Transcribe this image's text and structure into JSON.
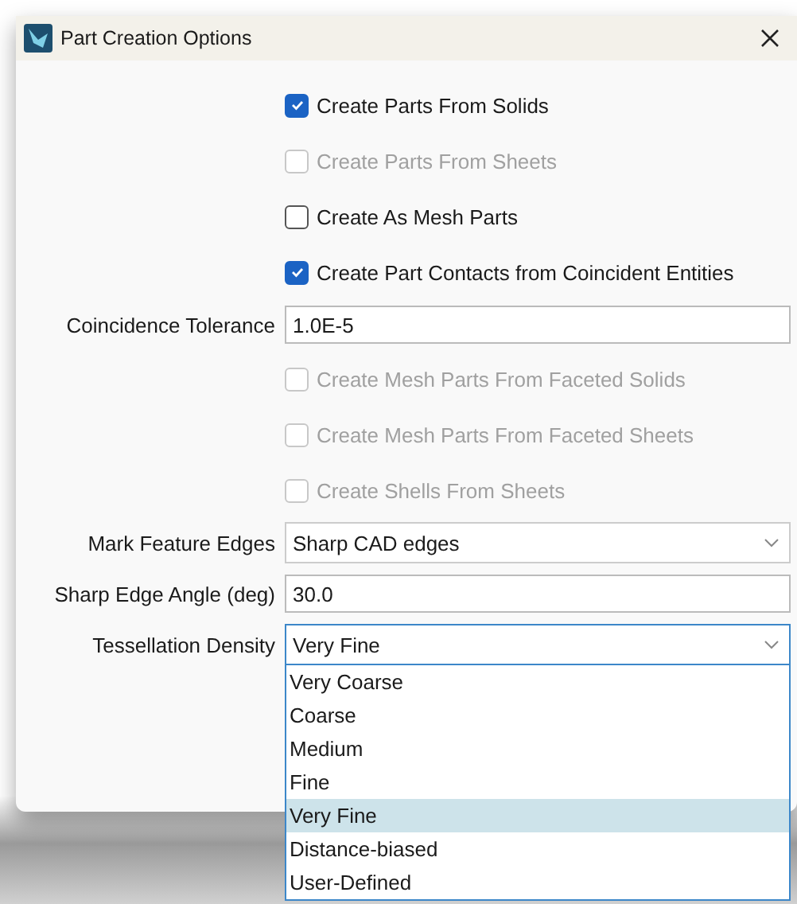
{
  "window": {
    "title": "Part Creation Options"
  },
  "rows": [
    {
      "kind": "checkbox",
      "label": "Create Parts From Solids",
      "checked": true,
      "disabled": false
    },
    {
      "kind": "checkbox",
      "label": "Create Parts From Sheets",
      "checked": false,
      "disabled": true
    },
    {
      "kind": "checkbox",
      "label": "Create As Mesh Parts",
      "checked": false,
      "disabled": false
    },
    {
      "kind": "checkbox",
      "label": "Create Part Contacts from Coincident Entities",
      "checked": true,
      "disabled": false
    },
    {
      "kind": "text",
      "label": "Coincidence Tolerance",
      "value": "1.0E-5"
    },
    {
      "kind": "checkbox",
      "label": "Create Mesh Parts From Faceted Solids",
      "checked": false,
      "disabled": true
    },
    {
      "kind": "checkbox",
      "label": "Create Mesh Parts From Faceted Sheets",
      "checked": false,
      "disabled": true
    },
    {
      "kind": "checkbox",
      "label": "Create Shells From Sheets",
      "checked": false,
      "disabled": true
    },
    {
      "kind": "combo",
      "label": "Mark Feature Edges",
      "value": "Sharp CAD edges",
      "expanded": false
    },
    {
      "kind": "text",
      "label": "Sharp Edge Angle (deg)",
      "value": "30.0"
    },
    {
      "kind": "combo",
      "label": "Tessellation Density",
      "value": "Very Fine",
      "expanded": true,
      "options": [
        {
          "label": "Very Coarse",
          "selected": false
        },
        {
          "label": "Coarse",
          "selected": false
        },
        {
          "label": "Medium",
          "selected": false
        },
        {
          "label": "Fine",
          "selected": false
        },
        {
          "label": "Very Fine",
          "selected": true
        },
        {
          "label": "Distance-biased",
          "selected": false
        },
        {
          "label": "User-Defined",
          "selected": false
        }
      ]
    }
  ]
}
